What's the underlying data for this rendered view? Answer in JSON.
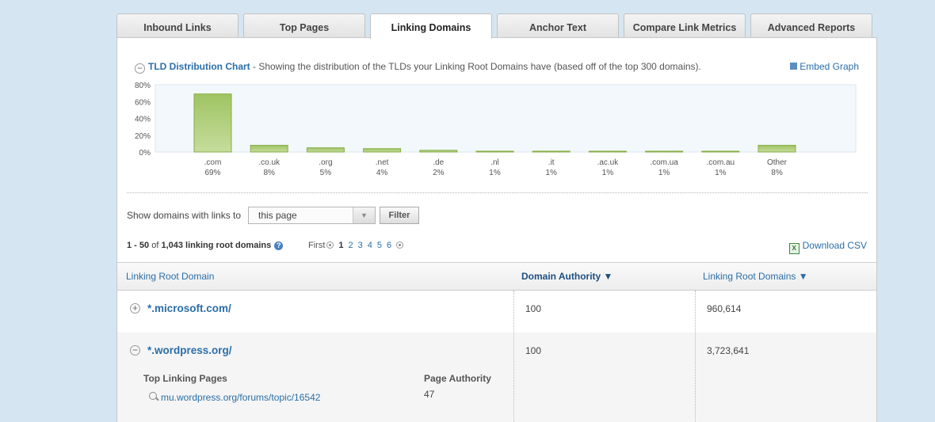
{
  "tabs": [
    {
      "label": "Inbound Links",
      "active": false
    },
    {
      "label": "Top Pages",
      "active": false
    },
    {
      "label": "Linking Domains",
      "active": true
    },
    {
      "label": "Anchor Text",
      "active": false
    },
    {
      "label": "Compare Link Metrics",
      "active": false
    },
    {
      "label": "Advanced Reports",
      "active": false
    }
  ],
  "chart_header": {
    "collapse_symbol": "−",
    "title": "TLD Distribution Chart",
    "description": " - Showing the distribution of the TLDs your Linking Root Domains have (based off of the top 300 domains).",
    "embed_label": "Embed Graph"
  },
  "chart_data": {
    "type": "bar",
    "title": "TLD Distribution Chart",
    "categories": [
      ".com",
      ".co.uk",
      ".org",
      ".net",
      ".de",
      ".nl",
      ".it",
      ".ac.uk",
      ".com.ua",
      ".com.au",
      "Other"
    ],
    "values": [
      69,
      8,
      5,
      4,
      2,
      1,
      1,
      1,
      1,
      1,
      8
    ],
    "value_labels": [
      "69%",
      "8%",
      "5%",
      "4%",
      "2%",
      "1%",
      "1%",
      "1%",
      "1%",
      "1%",
      "8%"
    ],
    "y_ticks": [
      "80%",
      "60%",
      "40%",
      "20%",
      "0%"
    ],
    "ylim": [
      0,
      80
    ],
    "grid": false,
    "legend": "none",
    "colors": {
      "bar_top": "#9fc462",
      "bar_bottom": "#c6dc9d",
      "bar_border": "#86ad48",
      "plot_bg": "#f3f8fc",
      "plot_border": "#dbe6ef"
    }
  },
  "filter": {
    "label": "Show domains with links to",
    "selected": "this page",
    "button": "Filter"
  },
  "results": {
    "range": "1 - 50",
    "of": "of",
    "total": "1,043",
    "suffix": "linking root domains",
    "help_icon": "question-icon"
  },
  "pager": {
    "first": "First",
    "pages": [
      "1",
      "2",
      "3",
      "4",
      "5",
      "6"
    ],
    "current": "1"
  },
  "download_label": "Download CSV",
  "table": {
    "columns": [
      "Linking Root Domain",
      "Domain Authority ▼",
      "Linking Root Domains ▼"
    ],
    "rows": [
      {
        "expander": "+",
        "domain": "*.microsoft.com/",
        "domain_authority": "100",
        "linking_root_domains": "960,614"
      },
      {
        "expander": "−",
        "domain": "*.wordpress.org/",
        "domain_authority": "100",
        "linking_root_domains": "3,723,641",
        "sub": {
          "header": "Top Linking Pages",
          "authority_header": "Page Authority",
          "page": "mu.wordpress.org/forums/topic/16542",
          "page_authority": "47"
        }
      }
    ]
  }
}
